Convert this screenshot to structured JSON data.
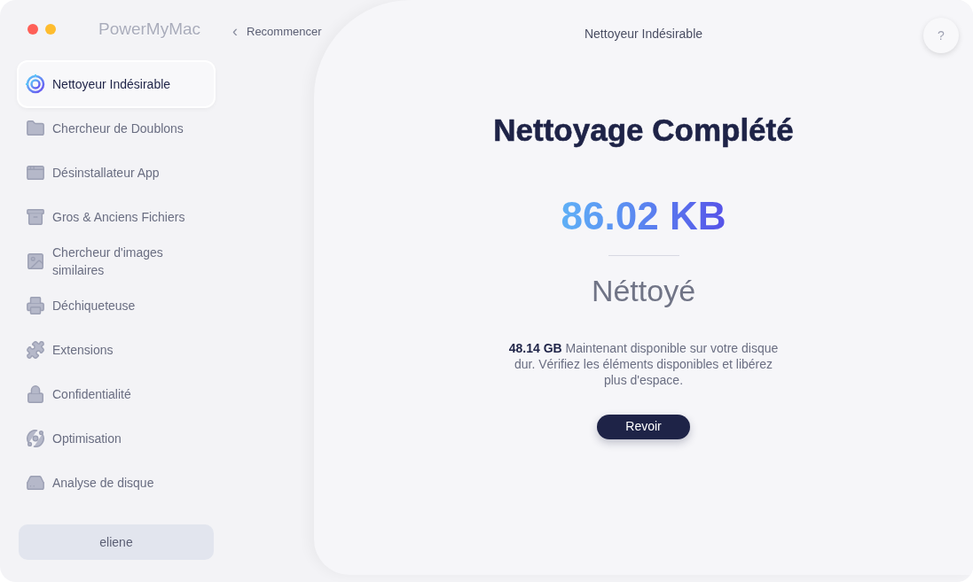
{
  "window": {
    "app_name": "PowerMyMac",
    "title": "Nettoyeur Indésirable"
  },
  "back_link": {
    "icon": "‹",
    "label": "Recommencer"
  },
  "help_button": {
    "label": "?"
  },
  "sidebar": {
    "items": [
      {
        "kind": "junk",
        "label": "Nettoyeur Indésirable",
        "selected": true
      },
      {
        "kind": "duplicates",
        "label": "Chercheur de Doublons",
        "selected": false
      },
      {
        "kind": "uninstaller",
        "label": "Désinstallateur App",
        "selected": false
      },
      {
        "kind": "large_files",
        "label": "Gros & Anciens Fichiers",
        "selected": false
      },
      {
        "kind": "images",
        "label": "Chercheur d'images similaires",
        "selected": false
      },
      {
        "kind": "shredder",
        "label": "Déchiqueteuse",
        "selected": false
      },
      {
        "kind": "extensions",
        "label": "Extensions",
        "selected": false
      },
      {
        "kind": "privacy",
        "label": "Confidentialité",
        "selected": false
      },
      {
        "kind": "optimization",
        "label": "Optimisation",
        "selected": false
      },
      {
        "kind": "disk",
        "label": "Analyse de disque",
        "selected": false
      }
    ],
    "user": "eliene"
  },
  "result": {
    "heading": "Nettoyage Complété",
    "amount": "86.02 KB",
    "status": "Néttoyé",
    "message": "**48.14 GB** Maintenant disponible sur votre disque dur. Vérifiez les éléments disponibles et libérez plus d'espace.",
    "button": "Revoir"
  }
}
